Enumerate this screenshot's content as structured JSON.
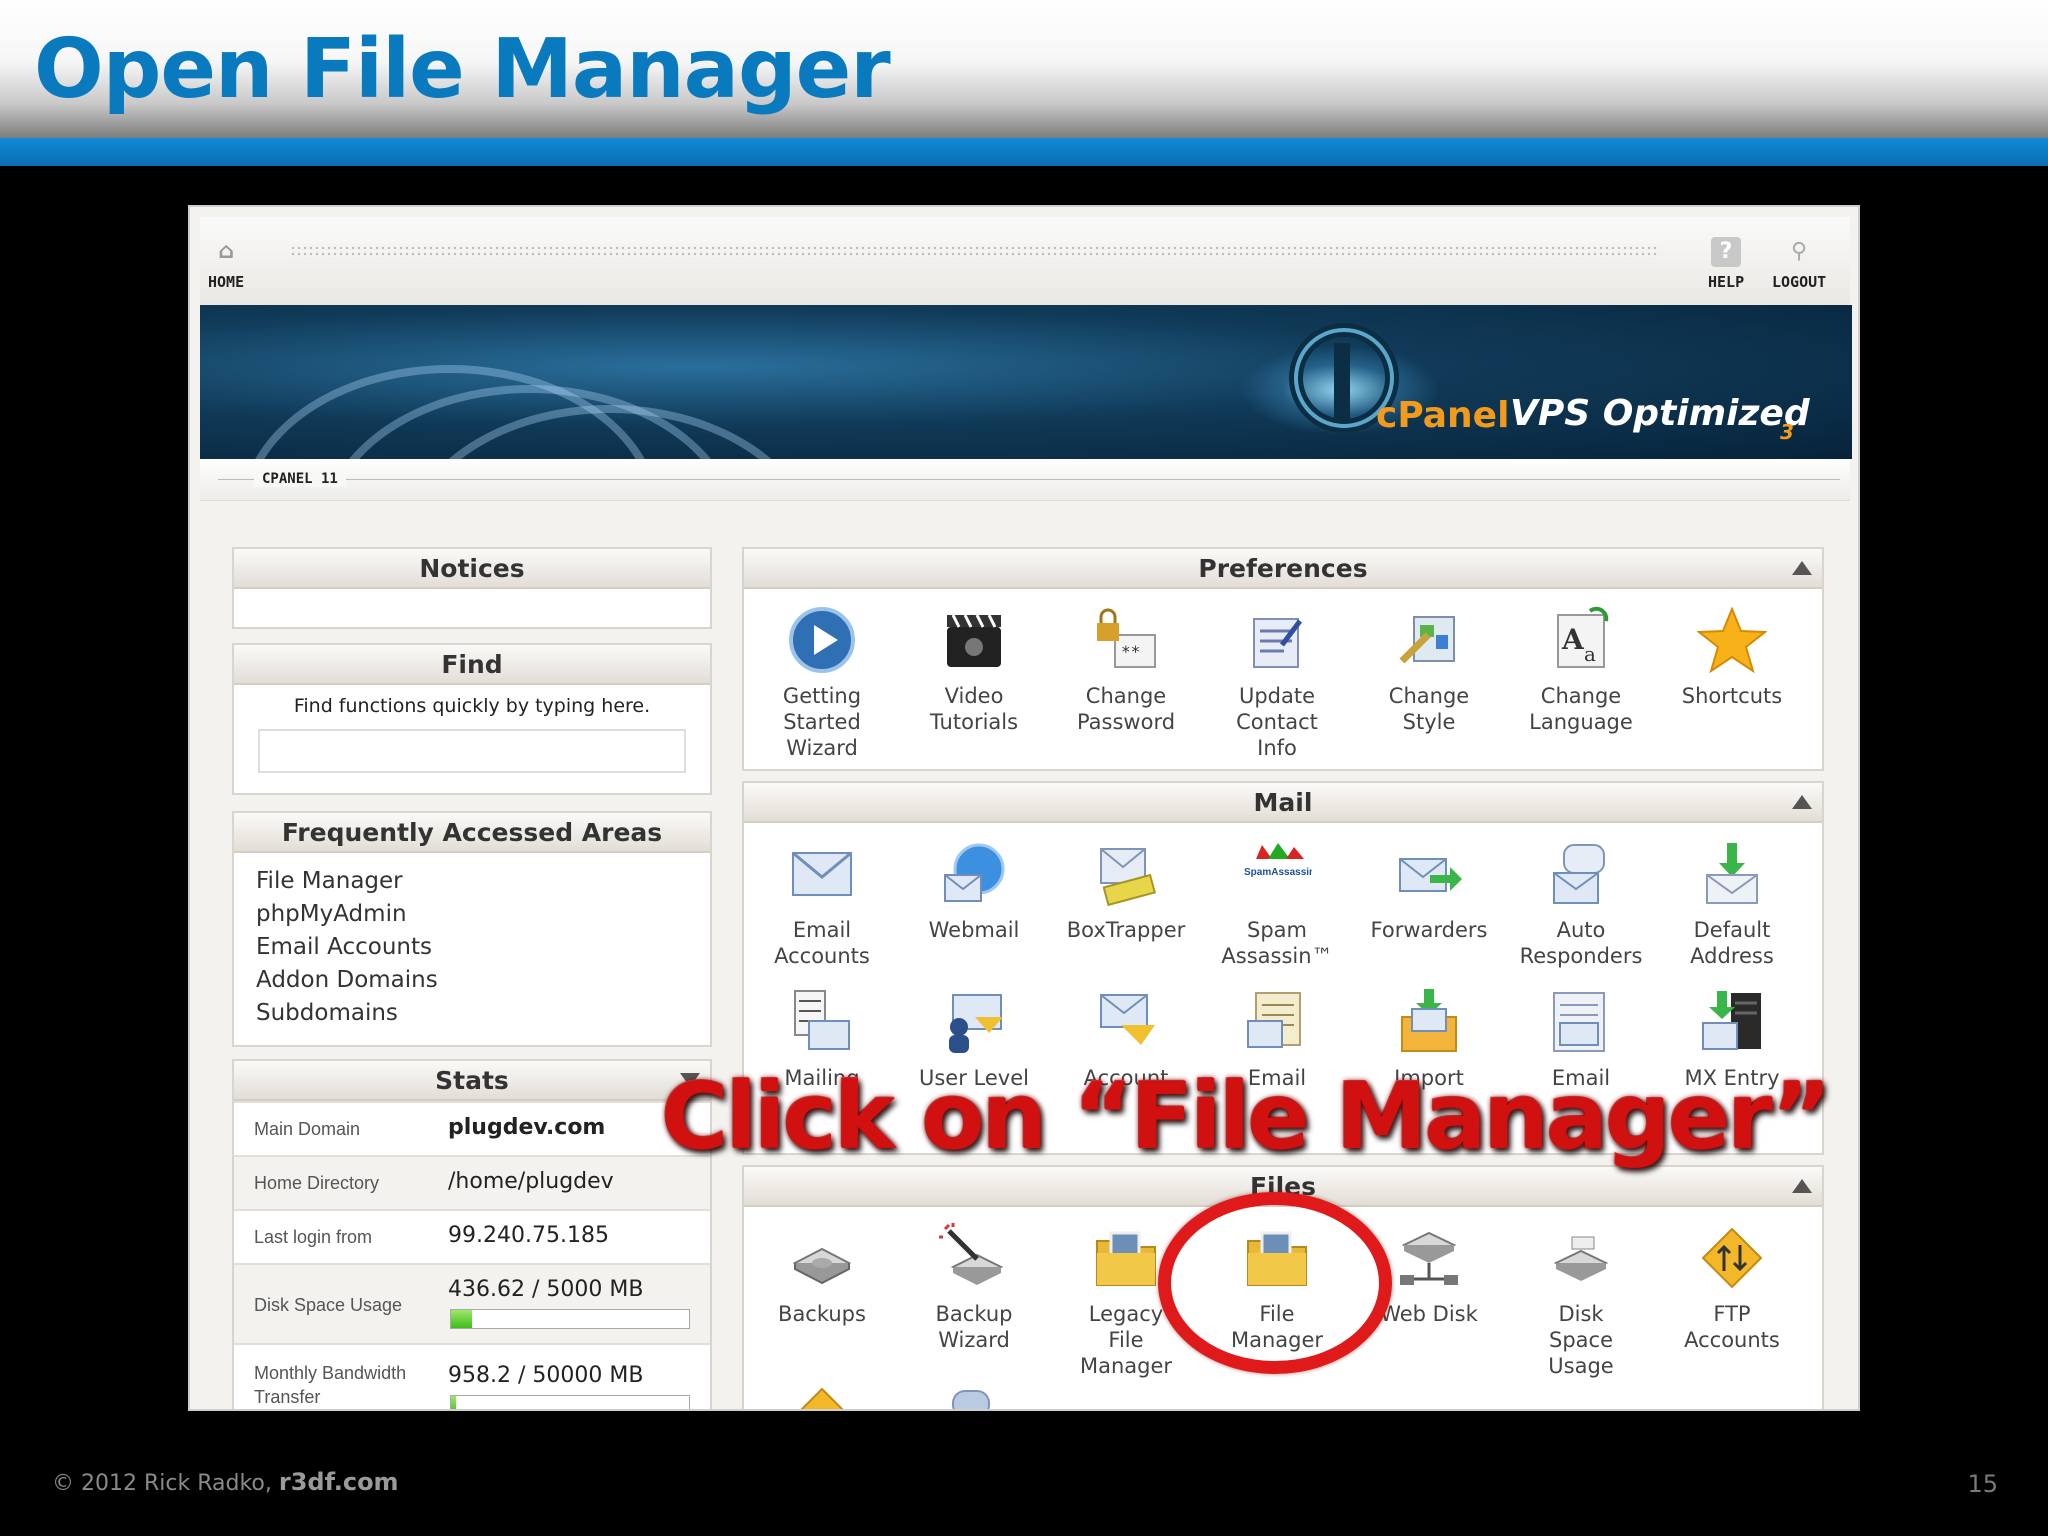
{
  "slide": {
    "title": "Open File Manager",
    "footer_copyright": "© 2012  Rick Radko,",
    "footer_site": "r3df.com",
    "page_number": "15"
  },
  "topbar": {
    "home_label": "HOME",
    "help_label": "HELP",
    "logout_label": "LOGOUT"
  },
  "banner": {
    "brand": "cPanel",
    "product": "VPS Optimized",
    "version": "3"
  },
  "breadcrumb": {
    "label": "CPANEL 11"
  },
  "notices": {
    "title": "Notices"
  },
  "find": {
    "title": "Find",
    "hint": "Find functions quickly by typing here.",
    "value": ""
  },
  "frequent": {
    "title": "Frequently Accessed Areas",
    "items": [
      "File Manager",
      "phpMyAdmin",
      "Email Accounts",
      "Addon Domains",
      "Subdomains"
    ]
  },
  "stats": {
    "title": "Stats",
    "rows": [
      {
        "key": "Main Domain",
        "value": "plugdev.com"
      },
      {
        "key": "Home Directory",
        "value": "/home/plugdev"
      },
      {
        "key": "Last login from",
        "value": "99.240.75.185"
      },
      {
        "key": "Disk Space Usage",
        "value": "436.62 / 5000 MB",
        "percent": 8.7
      },
      {
        "key": "Monthly Bandwidth",
        "key2": "Transfer",
        "value": "958.2 / 50000 MB",
        "percent": 1.9
      }
    ]
  },
  "preferences": {
    "title": "Preferences",
    "items": [
      {
        "l1": "Getting",
        "l2": "Started",
        "l3": "Wizard",
        "icon": "play-icon"
      },
      {
        "l1": "Video",
        "l2": "Tutorials",
        "l3": "",
        "icon": "clapperboard-icon"
      },
      {
        "l1": "Change",
        "l2": "Password",
        "l3": "",
        "icon": "lock-icon"
      },
      {
        "l1": "Update",
        "l2": "Contact",
        "l3": "Info",
        "icon": "contact-form-icon"
      },
      {
        "l1": "Change",
        "l2": "Style",
        "l3": "",
        "icon": "style-icon"
      },
      {
        "l1": "Change",
        "l2": "Language",
        "l3": "",
        "icon": "language-icon"
      },
      {
        "l1": "Shortcuts",
        "l2": "",
        "l3": "",
        "icon": "star-icon"
      }
    ]
  },
  "mail": {
    "title": "Mail",
    "spam_badge": "SpamAssassin",
    "row1": [
      {
        "l1": "Email",
        "l2": "Accounts",
        "icon": "envelope-icon"
      },
      {
        "l1": "Webmail",
        "l2": "",
        "icon": "globe-envelope-icon"
      },
      {
        "l1": "BoxTrapper",
        "l2": "",
        "icon": "box-trap-icon"
      },
      {
        "l1": "Spam",
        "l2": "Assassin™",
        "icon": "spamassassin-icon"
      },
      {
        "l1": "Forwarders",
        "l2": "",
        "icon": "forward-envelope-icon"
      },
      {
        "l1": "Auto",
        "l2": "Responders",
        "icon": "autoresponder-icon"
      },
      {
        "l1": "Default",
        "l2": "Address",
        "icon": "default-address-icon"
      }
    ],
    "row2": [
      {
        "l1": "Mailing",
        "icon": "mailing-list-icon"
      },
      {
        "l1": "User Level",
        "icon": "user-filter-icon"
      },
      {
        "l1": "Account",
        "icon": "account-filter-icon"
      },
      {
        "l1": "Email",
        "icon": "email-trace-icon"
      },
      {
        "l1": "Import",
        "icon": "import-icon"
      },
      {
        "l1": "Email",
        "icon": "email-auth-icon"
      },
      {
        "l1": "MX Entry",
        "icon": "mx-entry-icon"
      }
    ]
  },
  "files": {
    "title": "Files",
    "items": [
      {
        "l1": "Backups",
        "l2": "",
        "l3": "",
        "icon": "disk-drive-icon"
      },
      {
        "l1": "Backup",
        "l2": "Wizard",
        "l3": "",
        "icon": "wizard-wand-icon"
      },
      {
        "l1": "Legacy",
        "l2": "File",
        "l3": "Manager",
        "icon": "folder-icon"
      },
      {
        "l1": "File",
        "l2": "Manager",
        "l3": "",
        "icon": "folder-icon"
      },
      {
        "l1": "Web Disk",
        "l2": "",
        "l3": "",
        "icon": "network-disk-icon"
      },
      {
        "l1": "Disk",
        "l2": "Space",
        "l3": "Usage",
        "icon": "disk-usage-icon"
      },
      {
        "l1": "FTP",
        "l2": "Accounts",
        "l3": "",
        "icon": "ftp-icon"
      }
    ]
  },
  "callout": {
    "text": "Click on “File Manager”"
  },
  "colors": {
    "title_blue": "#0a7abf",
    "callout_red": "#d11010",
    "accent_bar": "#0f8bd6"
  }
}
